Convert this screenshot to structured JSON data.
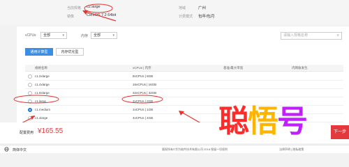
{
  "summary": {
    "spec_label": "当前规格",
    "spec_value": "c2.large",
    "image_label": "镜像",
    "image_value": "CentOS 7.2 64bit",
    "region_label": "地域",
    "region_value": "广州",
    "billing_label": "计费模式",
    "billing_value": "包年/包月"
  },
  "filters": {
    "vcpu_label": "vCPUs",
    "vcpu_value": "全部",
    "mem_label": "内存",
    "mem_value": "全部",
    "search_placeholder": "请输入规格名称"
  },
  "tabs": [
    {
      "label": "通用计算型",
      "active": true
    },
    {
      "label": "内存优化型",
      "active": false
    }
  ],
  "table": {
    "headers": [
      "规格名称",
      "vCPUs | 内存",
      "基准/最大带宽",
      "内网收发包"
    ],
    "rows": [
      {
        "name": "c1.2xlarge",
        "spec": "8vCPUs | 8GB",
        "selected": false
      },
      {
        "name": "c1.4xlarge",
        "spec": "16vCPUs | 16GB",
        "selected": false
      },
      {
        "name": "c1.8xlarge",
        "spec": "32vCPUs | 32GB",
        "selected": false
      },
      {
        "name": "c1.large",
        "spec": "2vCPUs | 2GB",
        "selected": false
      },
      {
        "name": "c1.medium",
        "spec": "1vCPUs | 1GB",
        "selected": true
      },
      {
        "name": "c1.xlarge",
        "spec": "4vCPUs | 4GB",
        "selected": false
      }
    ]
  },
  "price": {
    "label": "配置费用",
    "value": "¥165.55"
  },
  "cta": {
    "label": "下一步"
  },
  "footer": {
    "language": "简体中文",
    "copyright": "版权所有©华为软件技术有限公司 2018 保留一切权利",
    "links": "法律声明 | 隐私政策"
  },
  "watermark": {
    "text": [
      "聪",
      "悟",
      "号"
    ]
  },
  "annotations": {
    "color": "#e8322e"
  }
}
